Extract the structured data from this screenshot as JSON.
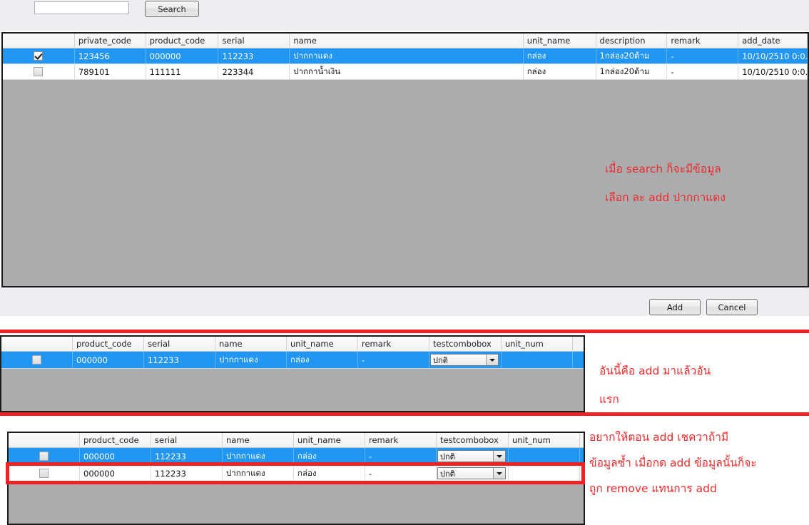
{
  "search": {
    "input_value": "",
    "placeholder": "",
    "button_label": "Search"
  },
  "result_grid": {
    "columns": [
      "",
      "private_code",
      "product_code",
      "serial",
      "name",
      "unit_name",
      "description",
      "remark",
      "add_date"
    ],
    "rows": [
      {
        "checked": true,
        "selected": true,
        "private_code": "123456",
        "product_code": "000000",
        "serial": "112233",
        "name": "ปากกาแดง",
        "unit_name": "กล่อง",
        "description": "1กล่อง20ด้าม",
        "remark": "-",
        "add_date": "10/10/2510 0:0..."
      },
      {
        "checked": false,
        "selected": false,
        "private_code": "789101",
        "product_code": "111111",
        "serial": "223344",
        "name": "ปากกาน้ำเงิน",
        "unit_name": "กล่อง",
        "description": "1กล่อง20ด้าม",
        "remark": "-",
        "add_date": "10/10/2510 0:0..."
      }
    ]
  },
  "actions": {
    "add_label": "Add",
    "cancel_label": "Cancel"
  },
  "cart_grid": {
    "columns": [
      "",
      "product_code",
      "serial",
      "name",
      "unit_name",
      "remark",
      "testcombobox",
      "unit_num"
    ],
    "rows": [
      {
        "checked": false,
        "selected": true,
        "product_code": "000000",
        "serial": "112233",
        "name": "ปากกาแดง",
        "unit_name": "กล่อง",
        "remark": "-",
        "testcombobox": "ปกติ",
        "unit_num": ""
      }
    ]
  },
  "dup_grid": {
    "columns": [
      "",
      "product_code",
      "serial",
      "name",
      "unit_name",
      "remark",
      "testcombobox",
      "unit_num"
    ],
    "rows": [
      {
        "checked": false,
        "selected": true,
        "product_code": "000000",
        "serial": "112233",
        "name": "ปากกาแดง",
        "unit_name": "กล่อง",
        "remark": "-",
        "testcombobox": "ปกติ",
        "unit_num": ""
      },
      {
        "checked": false,
        "selected": false,
        "highlighted": true,
        "product_code": "000000",
        "serial": "112233",
        "name": "ปากกาแดง",
        "unit_name": "กล่อง",
        "remark": "-",
        "testcombobox": "ปกติ",
        "unit_num": ""
      }
    ]
  },
  "annotations": {
    "accent_color": "#ee2222",
    "top": {
      "line1": "เมื่อ   search ก็จะมีข้อมูล",
      "line2": "เลือก   ละ add   ปากกาแดง"
    },
    "middle": {
      "line1": "อันนี้คือ   add   มาแล้วอัน",
      "line2": "แรก"
    },
    "bottom": {
      "line1": "อยากให้ตอน   add   เชควาถ้ามี",
      "line2": "ข้อมูลซ้ำ   เมื่อกด add ข้อมูลนั้นก็จะ",
      "line3": "ถูก   remove แทนการ add"
    }
  }
}
